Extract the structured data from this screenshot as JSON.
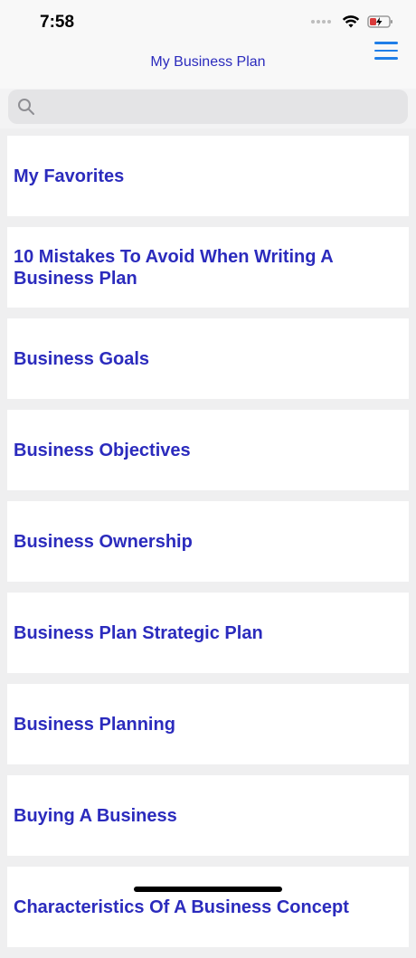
{
  "status_bar": {
    "time": "7:58",
    "icons": [
      "signal-dots-icon",
      "wifi-icon",
      "battery-charging-icon"
    ]
  },
  "nav": {
    "title": "My Business Plan",
    "menu_icon": "hamburger-menu-icon"
  },
  "search": {
    "placeholder": "",
    "value": "",
    "icon": "search-icon"
  },
  "colors": {
    "accent": "#2b2bbd",
    "menu_icon": "#1f7ee8",
    "background": "#efeff0"
  },
  "list": {
    "items": [
      {
        "label": "My Favorites"
      },
      {
        "label": "10 Mistakes To Avoid When Writing A Business Plan"
      },
      {
        "label": "Business Goals"
      },
      {
        "label": "Business Objectives"
      },
      {
        "label": "Business Ownership"
      },
      {
        "label": "Business Plan Strategic Plan"
      },
      {
        "label": "Business Planning"
      },
      {
        "label": "Buying A Business"
      },
      {
        "label": "Characteristics Of A Business Concept"
      }
    ]
  }
}
